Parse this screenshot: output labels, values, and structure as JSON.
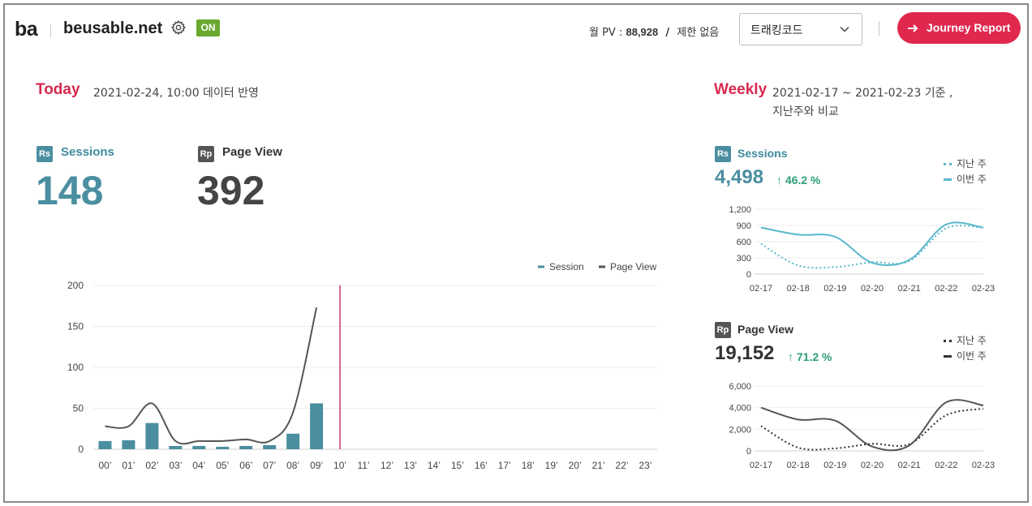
{
  "header": {
    "logo": "ba",
    "site": "beusable.net",
    "status_badge": "ON",
    "pv_label": "월 PV :",
    "pv_value": "88,928",
    "pv_slash": "/",
    "pv_limit": "제한 없음",
    "select_value": "트래킹코드",
    "journey_button": "Journey Report"
  },
  "today": {
    "title": "Today",
    "date": "2021-02-24, 10:00 데이터 반영",
    "sessions_icon": "Rs",
    "sessions_label": "Sessions",
    "sessions_value": "148",
    "pageview_icon": "Rp",
    "pageview_label": "Page View",
    "pageview_value": "392"
  },
  "weekly": {
    "title": "Weekly",
    "date_line1": "2021-02-17 ~ 2021-02-23 기준 ,",
    "date_line2": "지난주와 비교",
    "sessions": {
      "icon": "Rs",
      "label": "Sessions",
      "value": "4,498",
      "change": "↑ 46.2 %",
      "legend_last": "지난 주",
      "legend_this": "이번 주"
    },
    "pageview": {
      "icon": "Rp",
      "label": "Page View",
      "value": "19,152",
      "change": "↑ 71.2 %",
      "legend_last": "지난 주",
      "legend_this": "이번 주"
    }
  },
  "colors": {
    "accent": "#d6294e",
    "session": "#4a8ea0",
    "session_light": "#5ab8cc",
    "pageview": "#555555",
    "positive": "#2e9f75",
    "marker": "#c2185b"
  },
  "chart_data": [
    {
      "type": "bar",
      "legend": [
        "Session",
        "Page View"
      ],
      "categories": [
        "00’",
        "01’",
        "02’",
        "03’",
        "04’",
        "05’",
        "06’",
        "07’",
        "08’",
        "09’",
        "10’",
        "11’",
        "12’",
        "13’",
        "14’",
        "15’",
        "16’",
        "17’",
        "18’",
        "19’",
        "20’",
        "21’",
        "22’",
        "23’"
      ],
      "series": [
        {
          "name": "Session",
          "type": "bar",
          "values": [
            10,
            11,
            32,
            4,
            4,
            3,
            4,
            5,
            19,
            56
          ]
        },
        {
          "name": "Page View",
          "type": "line",
          "values": [
            28,
            28,
            56,
            10,
            10,
            10,
            12,
            10,
            45,
            173
          ]
        }
      ],
      "current_hour": "10’",
      "ylim": [
        0,
        200
      ],
      "yticks": [
        0,
        50,
        100,
        150,
        200
      ]
    },
    {
      "type": "line",
      "title": "Sessions",
      "categories": [
        "02-17",
        "02-18",
        "02-19",
        "02-20",
        "02-21",
        "02-22",
        "02-23"
      ],
      "series": [
        {
          "name": "지난 주",
          "values": [
            560,
            160,
            130,
            220,
            240,
            850,
            860
          ]
        },
        {
          "name": "이번 주",
          "values": [
            860,
            730,
            690,
            210,
            260,
            920,
            860
          ]
        }
      ],
      "ylim": [
        0,
        1200
      ],
      "yticks": [
        "0",
        "300",
        "600",
        "900",
        "1,200"
      ]
    },
    {
      "type": "line",
      "title": "Page View",
      "categories": [
        "02-17",
        "02-18",
        "02-19",
        "02-20",
        "02-21",
        "02-22",
        "02-23"
      ],
      "series": [
        {
          "name": "지난 주",
          "values": [
            2300,
            300,
            230,
            650,
            620,
            3300,
            3900
          ]
        },
        {
          "name": "이번 주",
          "values": [
            4000,
            2900,
            2800,
            400,
            500,
            4500,
            4200
          ]
        }
      ],
      "ylim": [
        0,
        6000
      ],
      "yticks": [
        "0",
        "2,000",
        "4,000",
        "6,000"
      ]
    }
  ]
}
